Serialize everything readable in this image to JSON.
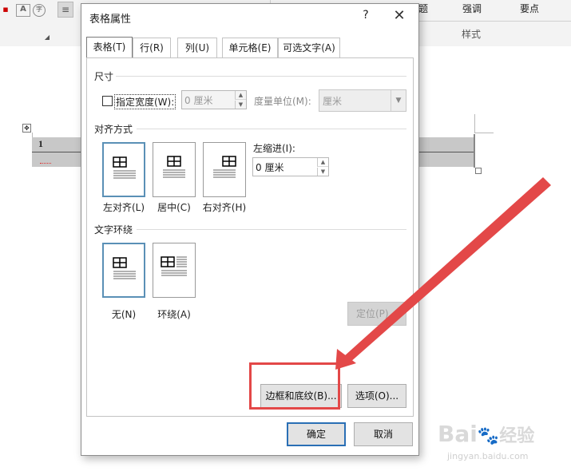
{
  "ribbon": {
    "style_items": [
      "题",
      "强调",
      "要点"
    ],
    "group_label": "样式",
    "icons": [
      "font-a-icon",
      "char-border-icon",
      "align-left-icon"
    ]
  },
  "document": {
    "cell_text": "1"
  },
  "dialog": {
    "title": "表格属性",
    "help_symbol": "?",
    "close_symbol": "✕",
    "tabs": [
      {
        "label": "表格(T)",
        "active": true
      },
      {
        "label": "行(R)",
        "active": false
      },
      {
        "label": "列(U)",
        "active": false
      },
      {
        "label": "单元格(E)",
        "active": false
      },
      {
        "label": "可选文字(A)",
        "active": false
      }
    ],
    "size": {
      "heading": "尺寸",
      "specify_width_label": "指定宽度(W):",
      "width_value": "0 厘米",
      "measure_label": "度量单位(M):",
      "measure_value": "厘米"
    },
    "alignment": {
      "heading": "对齐方式",
      "options": [
        {
          "label": "左对齐(L)",
          "selected": true
        },
        {
          "label": "居中(C)",
          "selected": false
        },
        {
          "label": "右对齐(H)",
          "selected": false
        }
      ],
      "indent_label": "左缩进(I):",
      "indent_value": "0 厘米"
    },
    "wrapping": {
      "heading": "文字环绕",
      "options": [
        {
          "label": "无(N)",
          "selected": true
        },
        {
          "label": "环绕(A)",
          "selected": false
        }
      ],
      "position_button": "定位(P)..."
    },
    "borders_button": "边框和底纹(B)...",
    "options_button": "选项(O)...",
    "ok_button": "确定",
    "cancel_button": "取消"
  },
  "annotation": {
    "color": "#e34848"
  },
  "watermark": {
    "brand": "Bai",
    "brand_cn": "经验",
    "url": "jingyan.baidu.com"
  }
}
